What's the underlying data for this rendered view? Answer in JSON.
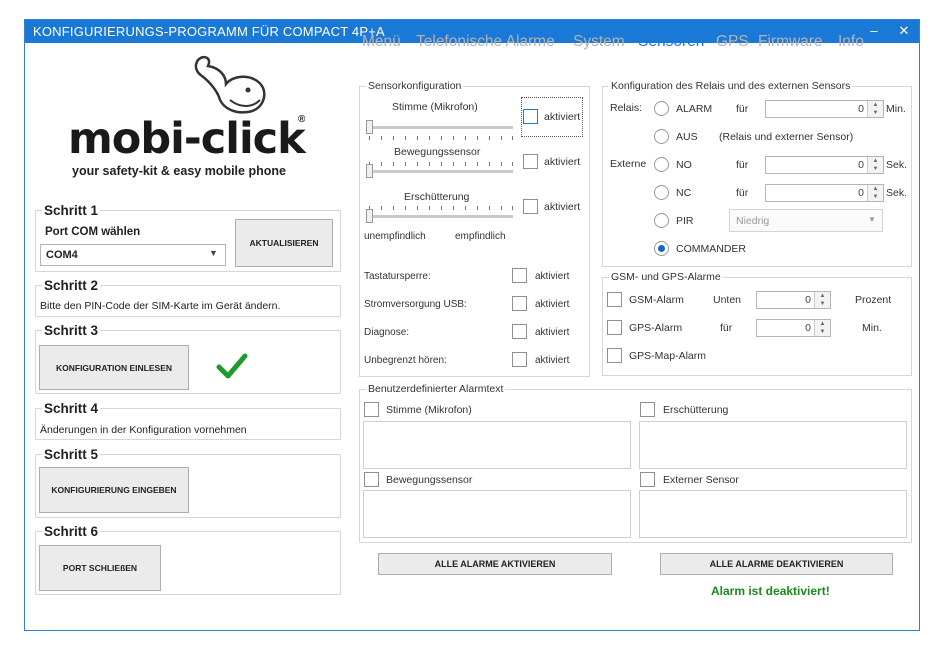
{
  "window": {
    "title": "KONFIGURIERUNGS-PROGRAMM FÜR COMPACT 4P+A",
    "minimize": "–",
    "close": "✕"
  },
  "logo": {
    "brand": "mobi-click",
    "registered": "®",
    "tagline": "your safety-kit & easy mobile phone"
  },
  "steps": {
    "s1": {
      "title": "Schritt 1",
      "port_label": "Port COM wählen",
      "port_value": "COM4",
      "refresh": "AKTUALISIEREN"
    },
    "s2": {
      "title": "Schritt 2",
      "text": "Bitte den PIN-Code der SIM-Karte im Gerät ändern."
    },
    "s3": {
      "title": "Schritt 3",
      "button": "KONFIGURATION EINLESEN"
    },
    "s4": {
      "title": "Schritt 4",
      "text": "Änderungen in der Konfiguration vornehmen"
    },
    "s5": {
      "title": "Schritt 5",
      "button": "KONFIGURIERUNG EINGEBEN"
    },
    "s6": {
      "title": "Schritt 6",
      "button": "PORT SCHLIEßEN"
    }
  },
  "tabs": [
    "Menü",
    "Telefonische Alarme",
    "System",
    "Sensoren",
    "GPS",
    "Firmware",
    "Info"
  ],
  "sensor": {
    "title": "Sensorkonfiguration",
    "voice": "Stimme (Mikrofon)",
    "motion": "Bewegungssensor",
    "shock": "Erschütterung",
    "active": "aktiviert",
    "insensitive": "unempfindlich",
    "sensitive": "empfindlich",
    "keylock": "Tastatursperre:",
    "usb": "Stromversorgung USB:",
    "diag": "Diagnose:",
    "listen": "Unbegrenzt hören:"
  },
  "relay": {
    "title": "Konfiguration des Relais und des externen Sensors",
    "relay_label": "Relais:",
    "alarm": "ALARM",
    "for": "für",
    "alarm_value": "0",
    "min": "Min.",
    "off": "AUS",
    "off_note": "(Relais und externer Sensor)",
    "external": "Externe",
    "no": "NO",
    "no_value": "0",
    "sec": "Sek.",
    "nc": "NC",
    "nc_value": "0",
    "pir": "PIR",
    "pir_level": "Niedrig",
    "commander": "COMMANDER"
  },
  "gsm": {
    "title": "GSM- und GPS-Alarme",
    "gsm_alarm": "GSM-Alarm",
    "below": "Unten",
    "gsm_value": "0",
    "percent": "Prozent",
    "gps_alarm": "GPS-Alarm",
    "for": "für",
    "gps_value": "0",
    "min": "Min.",
    "gps_map": "GPS-Map-Alarm"
  },
  "custom": {
    "title": "Benutzerdefinierter Alarmtext",
    "voice": "Stimme (Mikrofon)",
    "shock": "Erschütterung",
    "motion": "Bewegungssensor",
    "external": "Externer Sensor"
  },
  "actions": {
    "activate_all": "ALLE ALARME AKTIVIEREN",
    "deactivate_all": "ALLE ALARME DEAKTIVIEREN",
    "status": "Alarm ist deaktiviert!"
  },
  "colors": {
    "accent": "#1a78d7",
    "brand_red": "#c8102e",
    "success": "#1a8a1a"
  }
}
